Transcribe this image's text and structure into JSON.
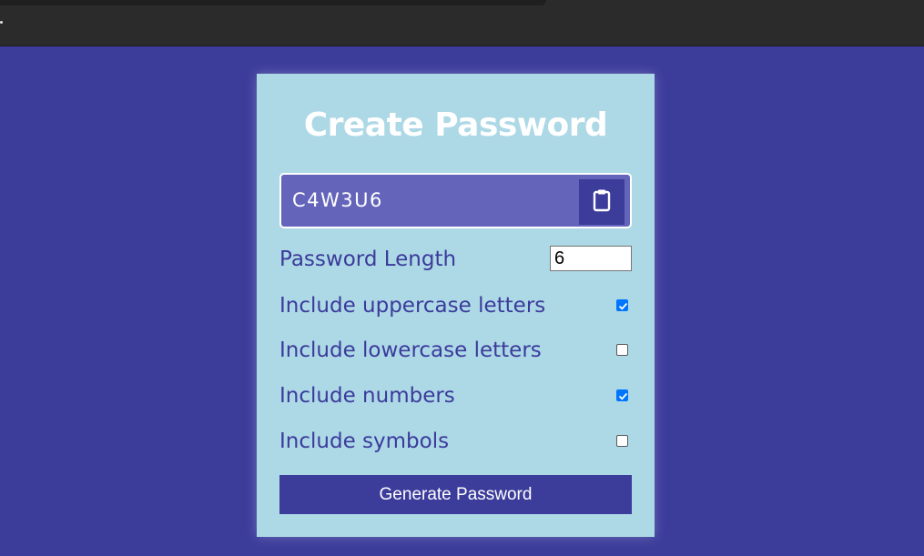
{
  "title": "Create Password",
  "result": {
    "value": "C4W3U6",
    "copy_icon": "clipboard-icon"
  },
  "length": {
    "label": "Password Length",
    "value": "6"
  },
  "options": [
    {
      "label": "Include uppercase letters",
      "checked": true
    },
    {
      "label": "Include lowercase letters",
      "checked": false
    },
    {
      "label": "Include numbers",
      "checked": true
    },
    {
      "label": "Include symbols",
      "checked": false
    }
  ],
  "generate_label": "Generate Password",
  "colors": {
    "background": "#3c3c9b",
    "card": "#add8e6",
    "result_box": "#6464bb",
    "accent_text": "#3b3b9b",
    "checkbox_checked": "#0075ff"
  }
}
